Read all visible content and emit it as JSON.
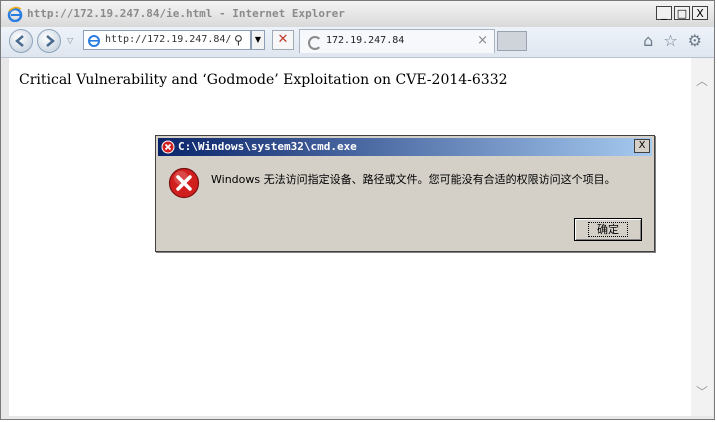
{
  "window": {
    "title": "http://172.19.247.84/ie.html - Internet Explorer",
    "min": "_",
    "max": "□",
    "close": "X"
  },
  "toolbar": {
    "url": "http://172.19.247.84/",
    "tab_title": "172.19.247.84",
    "tab_close": "×"
  },
  "page": {
    "heading": "Critical Vulnerability and ‘Godmode’ Exploitation on CVE-2014-6332"
  },
  "dialog": {
    "title": "C:\\Windows\\system32\\cmd.exe",
    "close": "X",
    "message": "Windows 无法访问指定设备、路径或文件。您可能没有合适的权限访问这个项目。",
    "ok_label": "确定"
  },
  "colors": {
    "dialog_title_start": "#0a246a",
    "dialog_title_end": "#a6caf0",
    "error_red": "#d11f1f"
  },
  "icons": [
    "ie-icon",
    "back-icon",
    "forward-icon",
    "page-icon",
    "search-icon",
    "stop-icon",
    "loading-icon",
    "home-icon",
    "favorites-icon",
    "settings-icon",
    "error-icon"
  ]
}
